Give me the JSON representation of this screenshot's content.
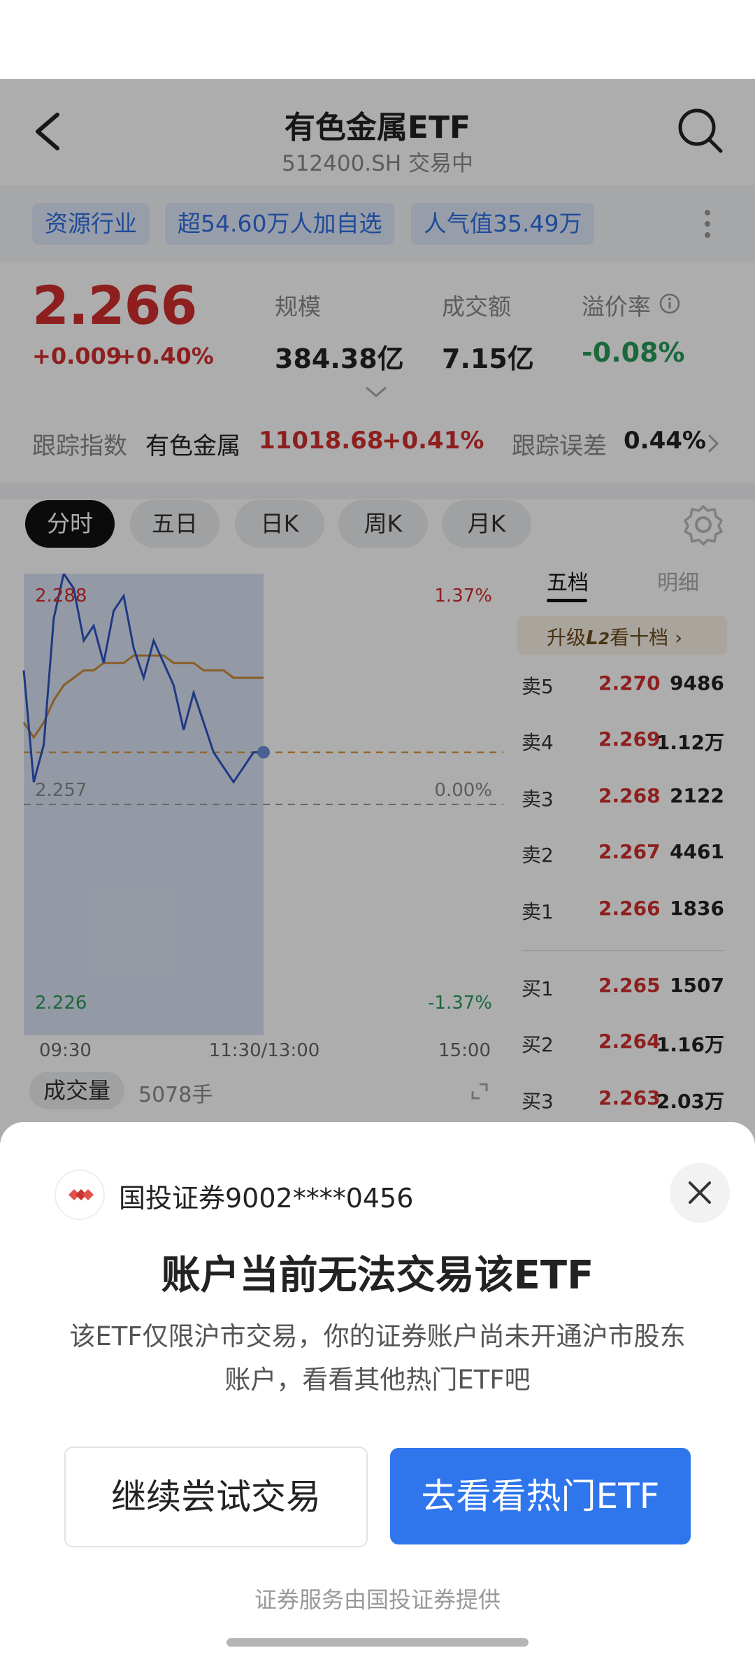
{
  "header": {
    "title": "有色金属ETF",
    "subtitle": "512400.SH 交易中"
  },
  "tags": [
    "资源行业",
    "超54.60万人加自选",
    "人气值35.49万"
  ],
  "quote": {
    "price": "2.266",
    "change": "+0.009",
    "change_pct": "+0.40%",
    "stats": [
      {
        "label": "规模",
        "value": "384.38亿"
      },
      {
        "label": "成交额",
        "value": "7.15亿"
      },
      {
        "label": "溢价率",
        "value": "-0.08%"
      }
    ]
  },
  "tracking": {
    "label": "跟踪指数",
    "index_name": "有色金属",
    "index_value": "11018.68",
    "index_change": "+0.41%",
    "error_label": "跟踪误差",
    "error_value": "0.44%"
  },
  "chart_tabs": [
    "分时",
    "五日",
    "日K",
    "周K",
    "月K"
  ],
  "active_chart_tab": "分时",
  "chart": {
    "price_high": "2.288",
    "price_mid": "2.257",
    "price_low": "2.226",
    "pct_high": "1.37%",
    "pct_mid": "0.00%",
    "pct_low": "-1.37%",
    "time_start": "09:30",
    "time_mid": "11:30/13:00",
    "time_end": "15:00"
  },
  "chart_data": {
    "type": "line",
    "x": [
      0,
      5,
      10,
      15,
      20,
      25,
      30,
      35,
      40,
      45,
      50,
      55,
      60,
      65,
      70,
      75,
      80,
      85,
      90,
      95,
      100,
      105,
      110,
      115,
      120
    ],
    "series": [
      {
        "values": [
          2.275,
          2.26,
          2.265,
          2.282,
          2.288,
          2.286,
          2.279,
          2.281,
          2.276,
          2.283,
          2.285,
          2.278,
          2.274,
          2.279,
          2.276,
          2.273,
          2.267,
          2.272,
          2.268,
          2.264,
          2.262,
          2.26,
          2.262,
          2.264,
          2.264
        ]
      },
      {
        "values": [
          2.268,
          2.266,
          2.268,
          2.271,
          2.273,
          2.274,
          2.275,
          2.275,
          2.276,
          2.276,
          2.276,
          2.277,
          2.277,
          2.277,
          2.277,
          2.276,
          2.276,
          2.276,
          2.275,
          2.275,
          2.275,
          2.274,
          2.274,
          2.274,
          2.274
        ]
      }
    ],
    "ylim": [
      2.226,
      2.288
    ],
    "reference": 2.257,
    "last_price": 2.266
  },
  "volume": {
    "label": "成交量",
    "value": "5078手"
  },
  "order_book": {
    "tabs": [
      "五档",
      "明细"
    ],
    "upgrade_text": "升级",
    "upgrade_text_2": "看十档",
    "asks": [
      {
        "label": "卖5",
        "price": "2.270",
        "qty": "9486"
      },
      {
        "label": "卖4",
        "price": "2.269",
        "qty": "1.12万"
      },
      {
        "label": "卖3",
        "price": "2.268",
        "qty": "2122"
      },
      {
        "label": "卖2",
        "price": "2.267",
        "qty": "4461"
      },
      {
        "label": "卖1",
        "price": "2.266",
        "qty": "1836"
      }
    ],
    "bids": [
      {
        "label": "买1",
        "price": "2.265",
        "qty": "1507"
      },
      {
        "label": "买2",
        "price": "2.264",
        "qty": "1.16万"
      },
      {
        "label": "买3",
        "price": "2.263",
        "qty": "2.03万"
      }
    ]
  },
  "sheet": {
    "broker": "国投证券9002****0456",
    "title": "账户当前无法交易该ETF",
    "desc": "该ETF仅限沪市交易，你的证券账户尚未开通沪市股东账户，看看其他热门ETF吧",
    "btn_secondary": "继续尝试交易",
    "btn_primary": "去看看热门ETF",
    "footer": "证券服务由国投证券提供"
  },
  "colors": {
    "up": "#d12e2e",
    "down": "#2a9a5a",
    "accent": "#2f76ed",
    "line": "#2b54c4",
    "avg": "#c98a3a"
  }
}
